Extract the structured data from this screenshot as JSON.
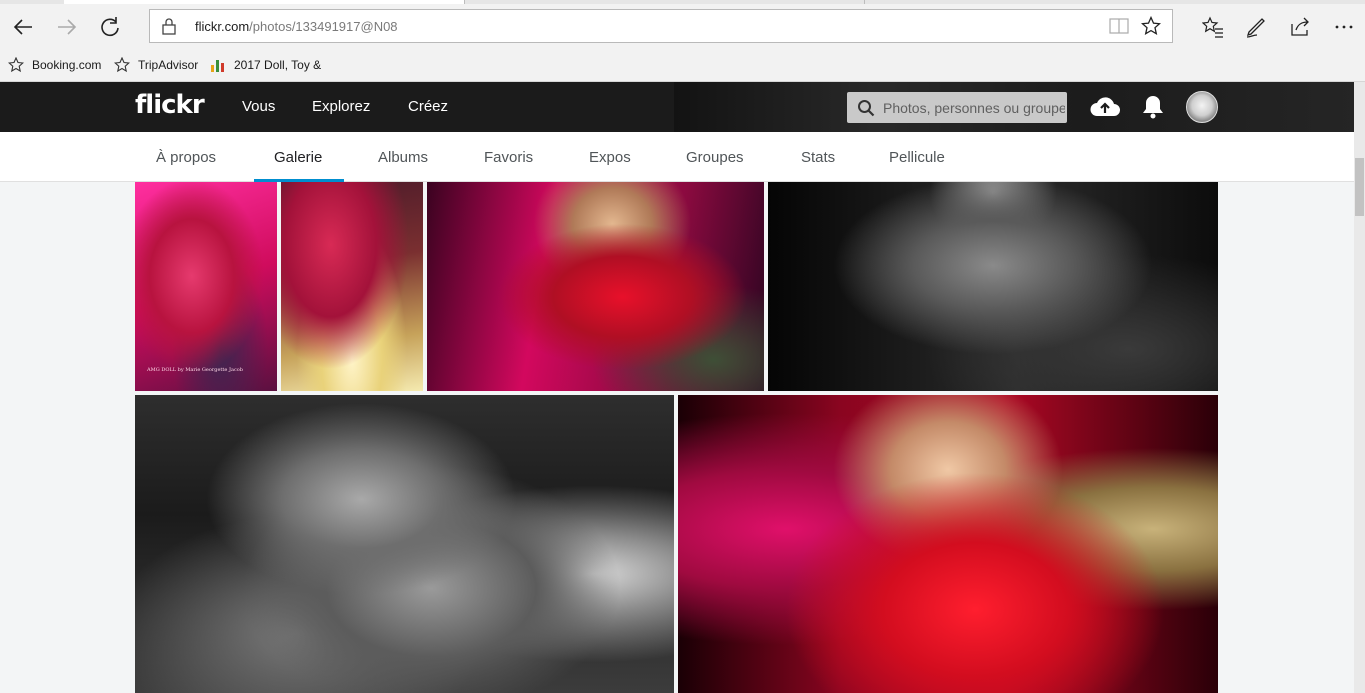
{
  "browser": {
    "url_domain": "flickr.com",
    "url_path": "/photos/133491917@N08",
    "favorites": [
      {
        "label": "Booking.com",
        "icon": "star-outline-icon"
      },
      {
        "label": "TripAdvisor",
        "icon": "star-outline-icon"
      },
      {
        "label": "2017 Doll, Toy &",
        "icon": "bar-chart-icon"
      }
    ]
  },
  "flickr": {
    "logo": "flickr",
    "nav": [
      "Vous",
      "Explorez",
      "Créez"
    ],
    "search_placeholder": "Photos, personnes ou groupes",
    "subnav": {
      "tabs": [
        "À propos",
        "Galerie",
        "Albums",
        "Favoris",
        "Expos",
        "Groupes",
        "Stats",
        "Pellicule"
      ],
      "active": "Galerie"
    },
    "photos": [
      {
        "caption": "AMG DOLL by Marie Georgette Jacob"
      }
    ],
    "colors": {
      "header_bg": "#1b1b1b",
      "accent": "#008ecf",
      "page_bg": "#f3f5f6"
    }
  }
}
